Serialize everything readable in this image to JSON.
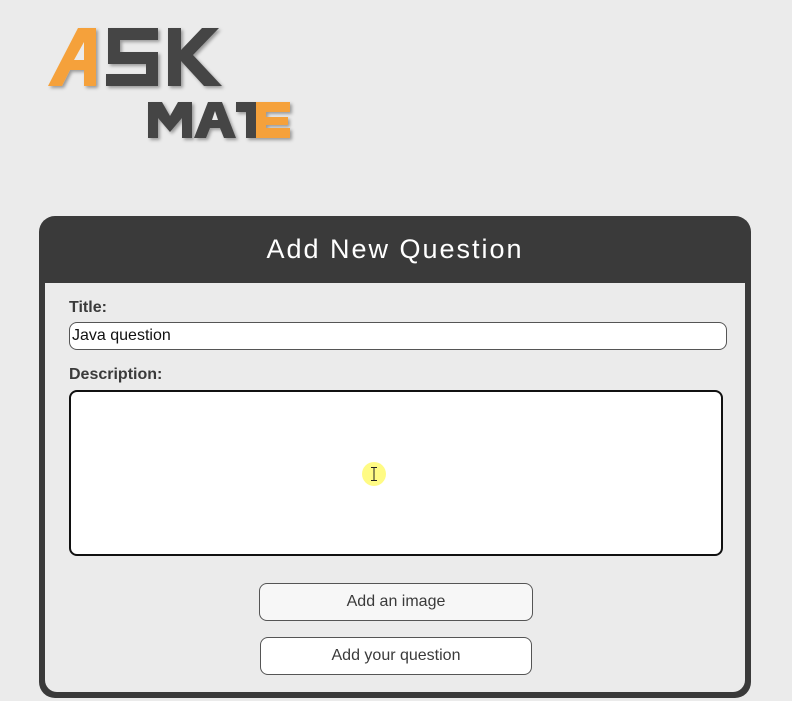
{
  "logo": {
    "word_top": "ASK",
    "word_bottom": "MATE",
    "colors": {
      "orange": "#f5a13a",
      "dark": "#444444"
    }
  },
  "form": {
    "heading": "Add New Question",
    "title_label": "Title:",
    "title_value": "Java question",
    "description_label": "Description:",
    "description_value": "",
    "add_image_label": "Add an image",
    "submit_label": "Add your question"
  },
  "theme": {
    "card_color": "#3a3a3a",
    "page_background": "#ebebeb",
    "cursor_highlight": "#fff86e"
  }
}
